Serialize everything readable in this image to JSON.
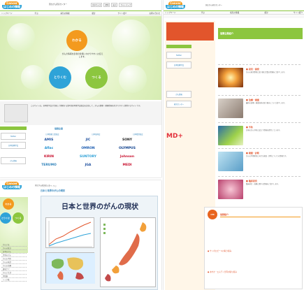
{
  "p1": {
    "logo_top": "Cancer",
    "logo_bottom": "はじめの情報",
    "org": "国立がん研究センター",
    "header_links": [
      "文字サイズ",
      "標準",
      "拡大",
      "サイトマップ"
    ],
    "nav": [
      "トップページ",
      "学ぶ",
      "病気の情報",
      "統計",
      "サイト紹介",
      "お問い合わせ"
    ],
    "circles": {
      "top": "わかる",
      "left": "とりくむ",
      "right": "つくる"
    },
    "hero_text": "がんの情報を患者の皆様にわかりやすくお伝えします。",
    "intro": "このサイトは、日本医学会が主催して開発する第1回日本医学会総会を記念して、がんの医療・健康情報をわかりやすく提供するサイトです。",
    "sponsor_title": "協賛企業",
    "sponsor_headers": [
      "日本製薬工業協会",
      "日本医師会",
      "日本看護協会"
    ],
    "sponsors": [
      "AMIS",
      "JIC",
      "SONY",
      "Aflac",
      "OMRON",
      "OLYMPUS",
      "KIRIN",
      "SUNTORY",
      "Johnson",
      "TERUMO",
      "JGA",
      "MEDI"
    ]
  },
  "p2": {
    "section": "協賛企業紹介",
    "items": [
      {
        "h": "■ 研究・開発",
        "t": "がんの研究開発に取り組む企業の情報をご紹介します。"
      },
      {
        "h": "■ 治療・検査",
        "t": "最新の治療・検査技術の取り組みについて紹介します。"
      },
      {
        "h": "■ 予防",
        "t": "日頃のがん予防に役立つ情報を提供しています。"
      },
      {
        "h": "■ 検査・診断",
        "t": "がんの早期発見に向けた検査・診断についての情報です。"
      },
      {
        "h": "■ 臨床研究",
        "t": "臨床研究・治験に関する情報をご紹介します。"
      }
    ],
    "mdplus": "MD+",
    "bottom_title": "協賛紹介",
    "links": [
      "● サッポロビールの取り組み",
      "● あすか・エムディ合同の取り組み"
    ]
  },
  "p3": {
    "breadcrumb": "トップページ > 学ぶ",
    "subtitle": "日本と世界のがんの現状",
    "hero_title": "日本と世界のがんの現状",
    "menu": [
      "がんとは",
      "がんの統計",
      "日本のがん",
      "世界のがん",
      "がんの予防",
      "がんの検診",
      "がんの治療",
      "緩和ケア",
      "がんと生活",
      "用語集",
      "リンク集"
    ]
  }
}
